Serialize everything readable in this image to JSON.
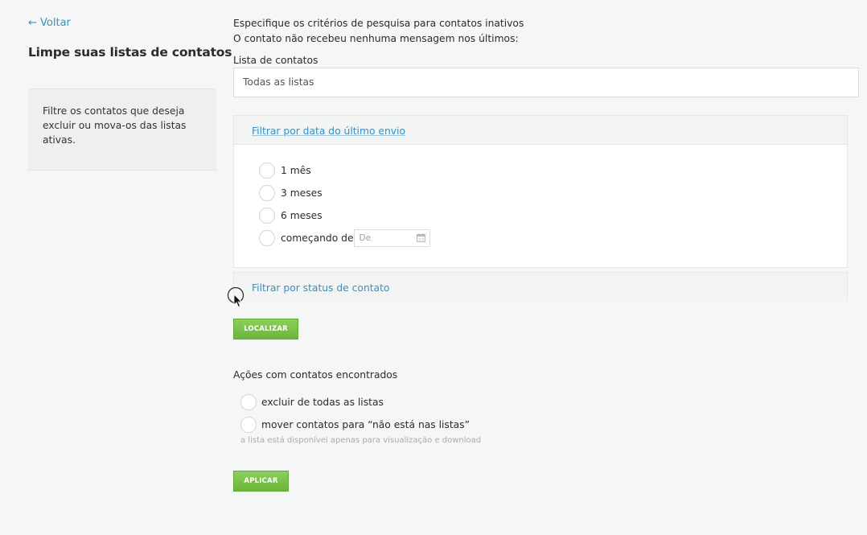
{
  "nav": {
    "back_label": "← Voltar"
  },
  "page": {
    "title": "Limpe suas listas de contatos"
  },
  "info": {
    "text": "Filtre os contatos que deseja excluir ou mova-os das listas ativas."
  },
  "criteria": {
    "line1": "Especifique os critérios de pesquisa para contatos inativos",
    "line2": "O contato não recebeu nenhuma mensagem nos últimos:"
  },
  "contact_list": {
    "label": "Lista de contatos",
    "selected": "Todas as listas"
  },
  "filter_date": {
    "header": "Filtrar por data do último envio",
    "options": [
      "1 mês",
      "3 meses",
      "6 meses",
      "começando de"
    ],
    "date_placeholder": "De"
  },
  "filter_status": {
    "header": "Filtrar por status de contato"
  },
  "find_button": "LOCALIZAR",
  "actions": {
    "title": "Ações com contatos encontrados",
    "options": [
      "excluir de todas as listas",
      "mover contatos para “não está nas listas”"
    ],
    "hint": "a lista está disponível apenas para visualização e download"
  },
  "apply_button": "APLICAR",
  "icons": {
    "calendar": "calendar-icon",
    "cursor": "mouse-pointer-icon"
  },
  "colors": {
    "accent": "#3a8fc1",
    "button": "#7cc24a"
  }
}
